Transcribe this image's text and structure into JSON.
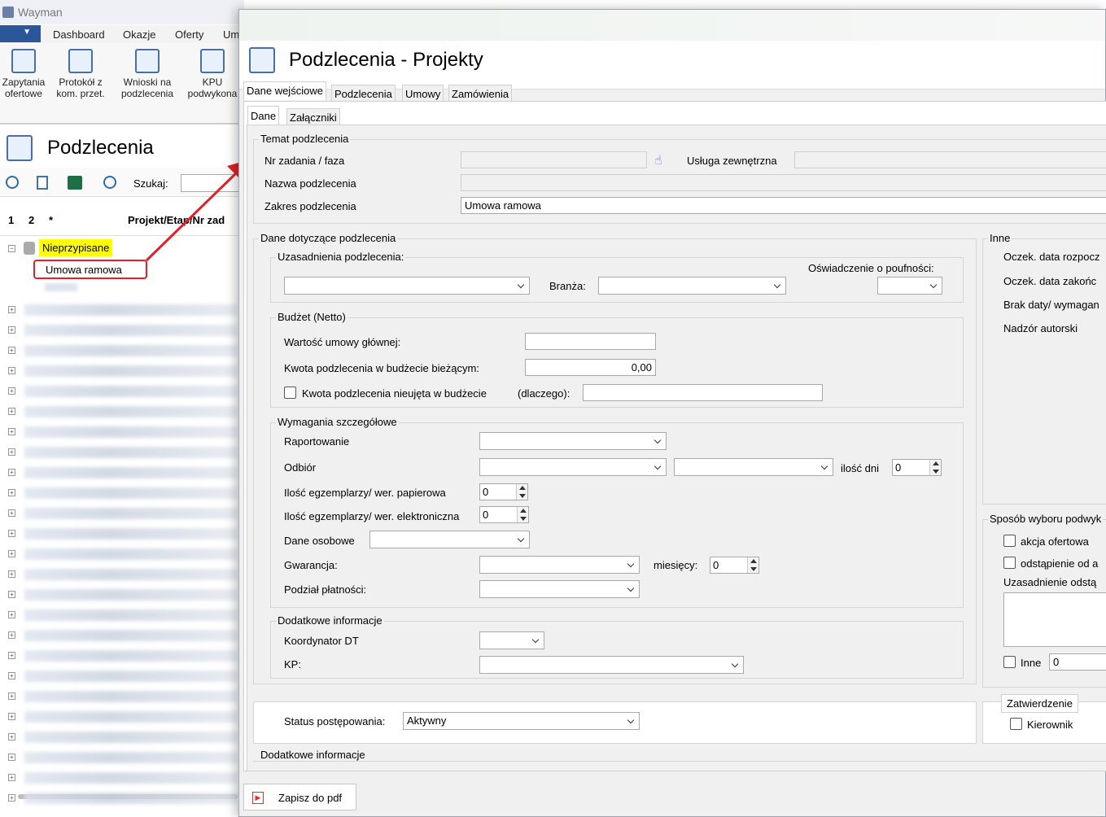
{
  "app": {
    "title": "Wayman",
    "menu": [
      "Dashboard",
      "Okazje",
      "Oferty",
      "Um"
    ],
    "ribbon": [
      {
        "label": "Zapytania ofertowe",
        "icon": "clipboard-icon"
      },
      {
        "label": "Protokół z kom. przet.",
        "icon": "document-pen-icon"
      },
      {
        "label": "Wnioski na podzlecenia",
        "icon": "documents-icon"
      },
      {
        "label": "KPU podwykona",
        "icon": "folder-check-icon"
      }
    ]
  },
  "list": {
    "title": "Podzlecenia",
    "search_label": "Szukaj:",
    "columns": [
      "1",
      "2",
      "*",
      "Projekt/Etap/Nr zad"
    ],
    "group_label": "Nieprzypisane",
    "selected_item": "Umowa ramowa"
  },
  "dialog": {
    "title": "Podzlecenia - Projekty",
    "tabs": [
      "Dane wejściowe",
      "Podzlecenia",
      "Umowy",
      "Zamówienia"
    ],
    "subtabs": [
      "Dane",
      "Załączniki"
    ],
    "temat": {
      "group": "Temat podzlecenia",
      "nr_zadania_label": "Nr zadania / faza",
      "usluga_label": "Usługa zewnętrzna",
      "nazwa_label": "Nazwa podzlecenia",
      "zakres_label": "Zakres podzlecenia",
      "zakres_value": "Umowa ramowa"
    },
    "dane": {
      "group": "Dane dotyczące podzlecenia",
      "uzasadnienia_label": "Uzasadnienia podzlecenia:",
      "branza_label": "Branża:",
      "oswiadczenie_label": "Oświadczenie o poufności:"
    },
    "budzet": {
      "group": "Budżet (Netto)",
      "wartosc_label": "Wartość umowy głównej:",
      "kwota_label": "Kwota podzlecenia w budżecie bieżącym:",
      "kwota_value": "0,00",
      "nieujeta_label": "Kwota podzlecenia nieujęta w budżecie",
      "dlaczego_label": "(dlaczego):"
    },
    "wymagania": {
      "group": "Wymagania szczegółowe",
      "raportowanie_label": "Raportowanie",
      "odbior_label": "Odbiór",
      "ilosc_dni_label": "ilość dni",
      "ilosc_dni_value": "0",
      "papierowa_label": "Ilość egzemplarzy/ wer. papierowa",
      "papierowa_value": "0",
      "elektroniczna_label": "Ilość egzemplarzy/ wer. elektroniczna",
      "elektroniczna_value": "0",
      "dane_osobowe_label": "Dane osobowe",
      "gwarancja_label": "Gwarancja:",
      "miesiecy_label": "miesięcy:",
      "miesiecy_value": "0",
      "podzial_label": "Podział płatności:"
    },
    "dodatkowe": {
      "group": "Dodatkowe informacje",
      "koordynator_label": "Koordynator DT",
      "kp_label": "KP:"
    },
    "inne": {
      "group": "Inne",
      "items": [
        "Oczek. data rozpocz",
        "Oczek. data zakońc",
        "Brak daty/ wymagan",
        "Nadzór autorski"
      ]
    },
    "sposob": {
      "group": "Sposób wyboru podwyk",
      "akcja_label": "akcja ofertowa",
      "odstapienie_label": "odstąpienie od a",
      "uzasadnienie_label": "Uzasadnienie odstą",
      "inne_label": "Inne",
      "inne_value": "0"
    },
    "status": {
      "label": "Status postępowania:",
      "value": "Aktywny"
    },
    "zatwierdzenie": {
      "group": "Zatwierdzenie",
      "kierownik_label": "Kierownik"
    },
    "dodatkowe_bottom": "Dodatkowe informacje",
    "pdf_button": "Zapisz do pdf"
  },
  "colors": {
    "annotation_red": "#e0202a",
    "highlight_yellow": "#ffff00",
    "menu_blue": "#2b579a"
  }
}
